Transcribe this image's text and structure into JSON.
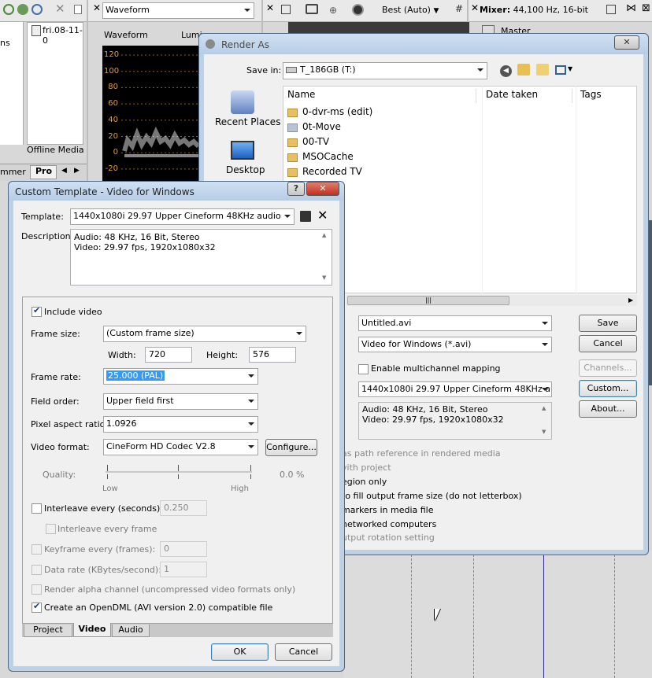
{
  "background": {
    "waveform_select": "Waveform",
    "waveform_label": "Waveform",
    "luminance_label": "Lumin",
    "scale_ticks": [
      "120",
      "100",
      "80",
      "60",
      "40",
      "20",
      "0",
      "-20"
    ],
    "preview_quality": "Best (Auto)",
    "mixer_label": "Mixer:",
    "mixer_value": "44,100 Hz, 16-bit",
    "master_label": "Master",
    "media_file": "fri.08-11-0",
    "offline_media": "Offline Media F",
    "side_text": "ns",
    "tab_trimmer": "mmer",
    "tab_project": "Pro"
  },
  "render_as": {
    "title": "Render As",
    "save_in_label": "Save in:",
    "save_in_value": "T_186GB (T:)",
    "places": [
      {
        "label": "Recent Places",
        "icon": "recent-places-icon"
      },
      {
        "label": "Desktop",
        "icon": "desktop-icon"
      }
    ],
    "columns": [
      "Name",
      "Date taken",
      "Tags"
    ],
    "files": [
      {
        "name": "0-dvr-ms (edit)",
        "icon": "folder-icon"
      },
      {
        "name": "0t-Move",
        "icon": "folder-special-icon"
      },
      {
        "name": "00-TV",
        "icon": "folder-icon"
      },
      {
        "name": "MSOCache",
        "icon": "folder-icon"
      },
      {
        "name": "Recorded TV",
        "icon": "folder-icon"
      }
    ],
    "file_name": "Untitled.avi",
    "save_as_type": "Video for Windows (*.avi)",
    "multichannel_label": "Enable multichannel mapping",
    "template": "1440x1080i 29.97 Upper Cineform 48KHz audio",
    "description_lines": [
      "Audio: 48 KHz, 16 Bit, Stereo",
      "Video: 29.97 fps, 1920x1080x32"
    ],
    "options": [
      "as path reference in rendered media",
      "vith project",
      "egion only",
      "to fill output frame size (do not letterbox)",
      "markers in media file",
      "networked computers",
      "utput rotation setting"
    ],
    "buttons": {
      "save": "Save",
      "cancel": "Cancel",
      "channels": "Channels...",
      "custom": "Custom...",
      "about": "About..."
    }
  },
  "custom_template": {
    "title": "Custom Template - Video for Windows",
    "template_label": "Template:",
    "template_value": "1440x1080i 29.97 Upper Cineform 48KHz audio",
    "description_label": "Description:",
    "description_lines": [
      "Audio: 48 KHz, 16 Bit, Stereo",
      "Video: 29.97 fps, 1920x1080x32"
    ],
    "include_video": "Include video",
    "frame_size_label": "Frame size:",
    "frame_size_value": "(Custom frame size)",
    "width_label": "Width:",
    "width_value": "720",
    "height_label": "Height:",
    "height_value": "576",
    "frame_rate_label": "Frame rate:",
    "frame_rate_value": "25.000 (PAL)",
    "field_order_label": "Field order:",
    "field_order_value": "Upper field first",
    "par_label": "Pixel aspect ratio:",
    "par_value": "1.0926",
    "video_format_label": "Video format:",
    "video_format_value": "CineForm HD Codec V2.8",
    "configure_label": "Configure...",
    "quality_label": "Quality:",
    "quality_low": "Low",
    "quality_high": "High",
    "quality_value": "0.0 %",
    "interleave_label": "Interleave every (seconds):",
    "interleave_value": "0.250",
    "interleave_frame_label": "Interleave every frame",
    "keyframe_label": "Keyframe every (frames):",
    "keyframe_value": "0",
    "datarate_label": "Data rate (KBytes/second):",
    "datarate_value": "1",
    "alpha_label": "Render alpha channel (uncompressed video formats only)",
    "opendml_label": "Create an OpenDML (AVI version 2.0) compatible file",
    "tabs": [
      "Project",
      "Video",
      "Audio"
    ],
    "active_tab": "Video",
    "ok": "OK",
    "cancel": "Cancel"
  }
}
